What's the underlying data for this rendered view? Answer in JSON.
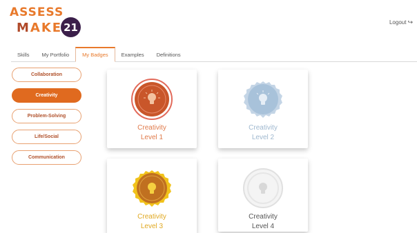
{
  "logo": {
    "line1": "ASSESS",
    "line2_prefix": "M",
    "line2_rest": "AKE",
    "badge": "21"
  },
  "header": {
    "logout_label": "Logout"
  },
  "tabs": [
    {
      "label": "Skills"
    },
    {
      "label": "My Portfolio"
    },
    {
      "label": "My Badges",
      "active": true
    },
    {
      "label": "Examples"
    },
    {
      "label": "Definitions"
    }
  ],
  "sidebar": {
    "items": [
      {
        "label": "Collaboration"
      },
      {
        "label": "Creativity",
        "active": true
      },
      {
        "label": "Problem-Solving"
      },
      {
        "label": "Life/Social"
      },
      {
        "label": "Communication"
      }
    ]
  },
  "badges": [
    {
      "name": "Creativity",
      "level": "Level 1",
      "text_color": "#e07a4a",
      "fill": "#c9562a",
      "ring": "#e26a5a",
      "icon": "lightbulb-icon"
    },
    {
      "name": "Creativity",
      "level": "Level 2",
      "text_color": "#9fb8cf",
      "fill": "#a8c2da",
      "ring": "#c4d5e6",
      "icon": "lightbulb-icon"
    },
    {
      "name": "Creativity",
      "level": "Level 3",
      "text_color": "#e0a820",
      "fill": "#c07020",
      "ring": "#f1c21b",
      "icon": "lightbulb-icon"
    },
    {
      "name": "Creativity",
      "level": "Level 4",
      "text_color": "#555555",
      "fill": "#f0f0f0",
      "ring": "#dedede",
      "icon": "lightbulb-icon"
    }
  ]
}
